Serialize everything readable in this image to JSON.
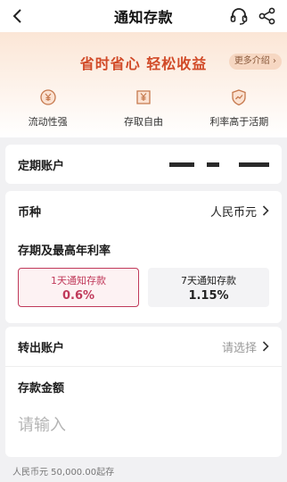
{
  "header": {
    "title": "通知存款",
    "icons": {
      "back": "back-arrow-icon",
      "service": "headset-icon",
      "share": "share-icon"
    }
  },
  "banner": {
    "slogan": "省时省心  轻松收益",
    "more_label": "更多介绍 ›",
    "features": [
      {
        "label": "流动性强",
        "icon": "yen-coin-icon"
      },
      {
        "label": "存取自由",
        "icon": "yen-box-icon"
      },
      {
        "label": "利率高于活期",
        "icon": "trend-shield-icon"
      }
    ]
  },
  "account": {
    "label": "定期账户"
  },
  "currency": {
    "label": "币种",
    "value": "人民币元"
  },
  "term": {
    "title": "存期及最高年利率",
    "options": [
      {
        "name": "1天通知存款",
        "rate": "0.6%",
        "selected": true
      },
      {
        "name": "7天通知存款",
        "rate": "1.15%",
        "selected": false
      }
    ]
  },
  "transfer_out": {
    "label": "转出账户",
    "value": "请选择"
  },
  "amount": {
    "title": "存款金额",
    "placeholder": "请输入"
  },
  "note": "人民币元 50,000.00起存",
  "colors": {
    "accent": "#c0395a",
    "slogan": "#d14a28",
    "banner_top": "#fbe6d6"
  }
}
